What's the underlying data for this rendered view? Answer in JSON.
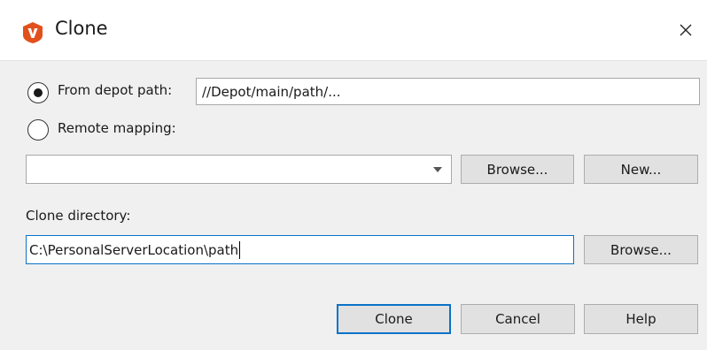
{
  "window": {
    "title": "Clone",
    "close_icon": "close-icon",
    "app_icon": "app-v-logo-icon",
    "brand_color": "#e2511b"
  },
  "source": {
    "depot_option_label": "From depot path:",
    "depot_path_value": "//Depot/main/path/...",
    "depot_selected": true,
    "remote_option_label": "Remote mapping:",
    "remote_selected": false,
    "remote_mapping_value": "",
    "browse_label": "Browse...",
    "new_label": "New..."
  },
  "clone_directory": {
    "label": "Clone directory:",
    "value": "C:\\PersonalServerLocation\\path",
    "browse_label": "Browse..."
  },
  "footer": {
    "clone_label": "Clone",
    "cancel_label": "Cancel",
    "help_label": "Help"
  }
}
